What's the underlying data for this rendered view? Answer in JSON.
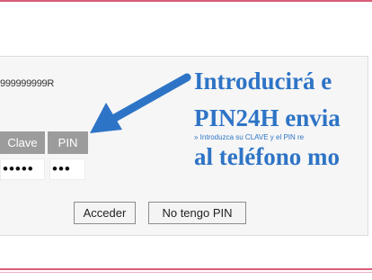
{
  "login": {
    "account_number": "999999999R",
    "fields": {
      "clave_label": "Clave",
      "pin_label": "PIN"
    },
    "values": {
      "clave_masked": "•••••",
      "pin_masked": "•••"
    },
    "buttons": {
      "acceder": "Acceder",
      "no_pin": "No tengo PIN"
    }
  },
  "annotation": {
    "line1": "Introducirá e",
    "line2": "PIN24H envia",
    "small": "» Introduzca su CLAVE y el PIN re",
    "line4": "al teléfono mo"
  },
  "colors": {
    "annotation": "#2e74c6",
    "field_header": "#9c9c9c",
    "rule": "#d95c78"
  }
}
